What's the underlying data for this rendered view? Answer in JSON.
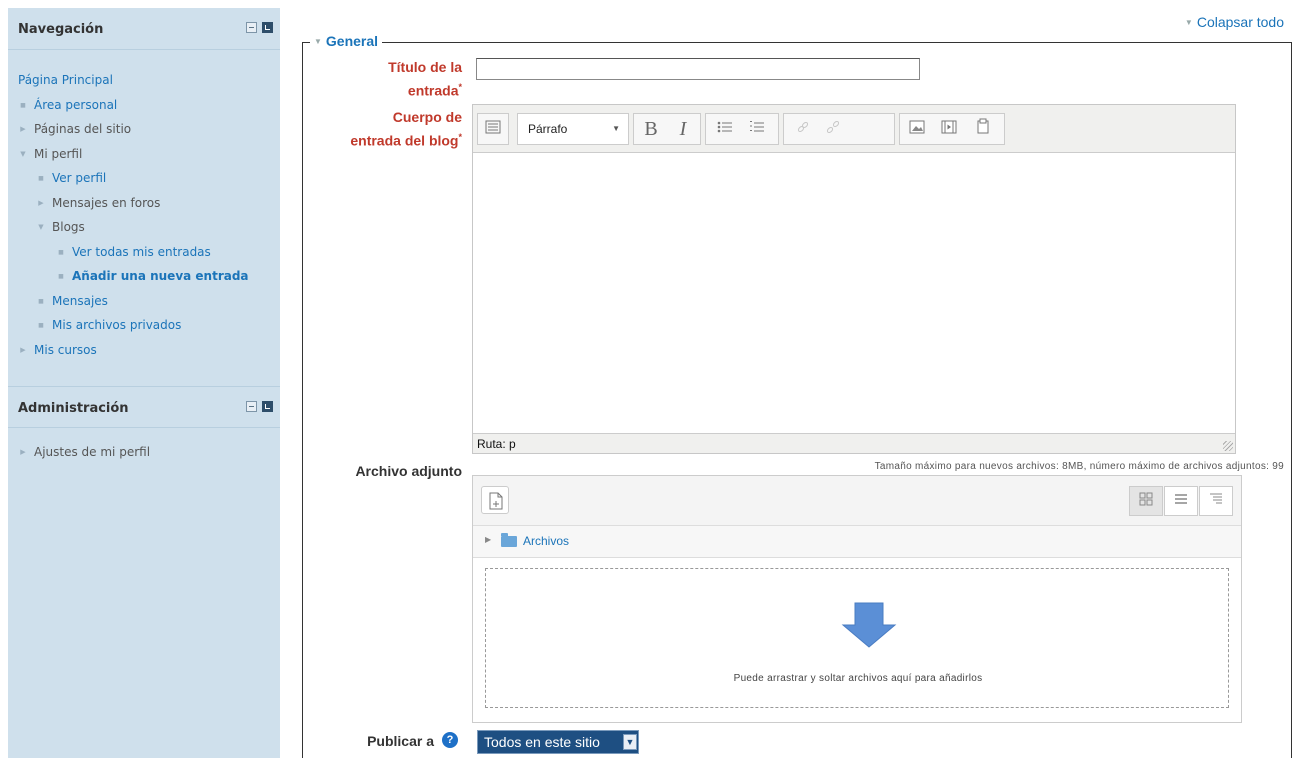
{
  "navigation": {
    "title": "Navegación",
    "items": [
      {
        "label": "Página Principal"
      },
      {
        "label": "Área personal"
      },
      {
        "label": "Páginas del sitio"
      },
      {
        "label": "Mi perfil"
      },
      {
        "label": "Ver perfil"
      },
      {
        "label": "Mensajes en foros"
      },
      {
        "label": "Blogs"
      },
      {
        "label": "Ver todas mis entradas"
      },
      {
        "label": "Añadir una nueva entrada"
      },
      {
        "label": "Mensajes"
      },
      {
        "label": "Mis archivos privados"
      },
      {
        "label": "Mis cursos"
      }
    ]
  },
  "administration": {
    "title": "Administración",
    "items": [
      {
        "label": "Ajustes de mi perfil"
      }
    ]
  },
  "main": {
    "collapse_all": "Colapsar todo",
    "section_title": "General",
    "title_label_line1": "Título de la",
    "title_label_line2": "entrada",
    "title_value": "",
    "body_label_line1": "Cuerpo de",
    "body_label_line2": "entrada del blog",
    "required_mark": "*",
    "format_value": "Párrafo",
    "editor_path": "Ruta: p",
    "attachment_label": "Archivo adjunto",
    "file_limits": "Tamaño máximo para nuevos archivos: 8MB, número máximo de archivos adjuntos: 99",
    "folder_name": "Archivos",
    "drop_text": "Puede arrastrar y soltar archivos aquí para añadirlos",
    "publish_label": "Publicar a",
    "publish_value": "Todos en este sitio"
  },
  "colors": {
    "sidebar_bg": "#cfe0ec",
    "link": "#1b74b9",
    "required": "#c0392b",
    "drop_arrow": "#5b8fd6",
    "select_bg": "#1e4f82"
  }
}
